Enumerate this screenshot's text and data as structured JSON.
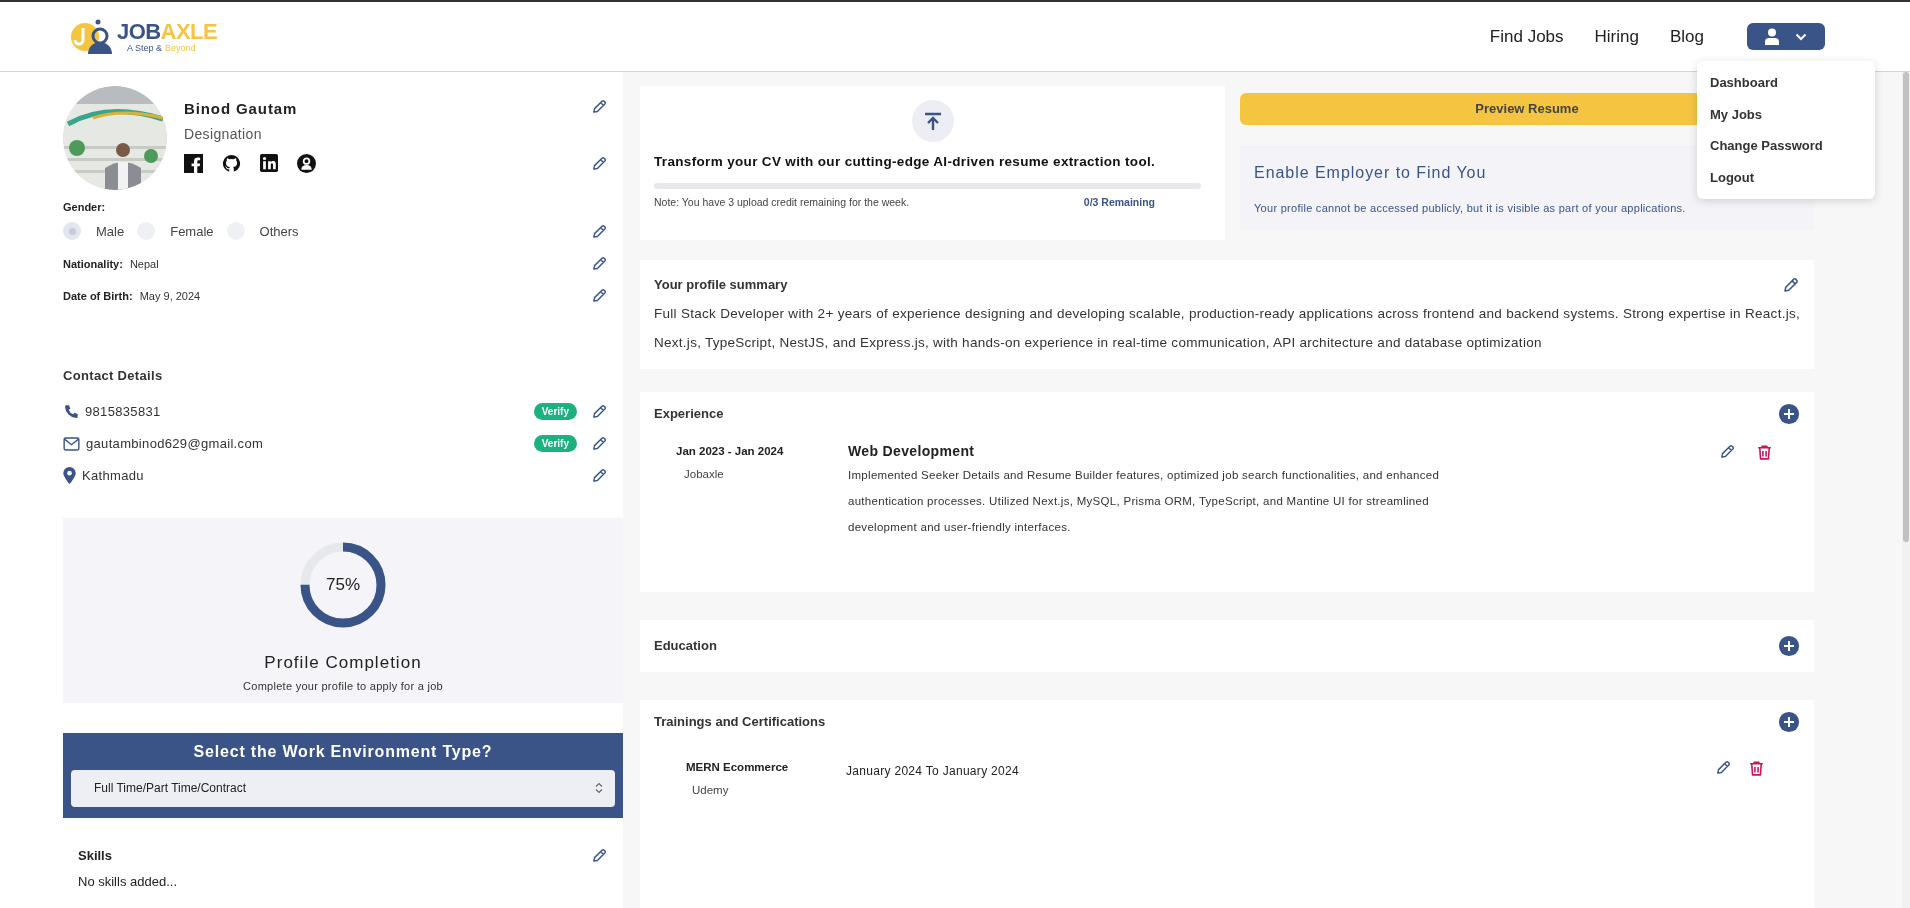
{
  "header": {
    "logo": {
      "name_part_1": "JOB",
      "name_part_2": "AXLE",
      "tagline_part_1": "A Step &",
      "tagline_part_2": "Beyond"
    },
    "nav": [
      {
        "label": "Find Jobs"
      },
      {
        "label": "Hiring"
      },
      {
        "label": "Blog"
      }
    ],
    "user_menu": {
      "expanded": true,
      "items": [
        {
          "label": "Dashboard"
        },
        {
          "label": "My Jobs"
        },
        {
          "label": "Change Password"
        },
        {
          "label": "Logout"
        }
      ]
    }
  },
  "profile": {
    "name": "Binod Gautam",
    "designation": "Designation",
    "gender": {
      "label": "Gender:",
      "options": [
        {
          "label": "Male",
          "selected": true
        },
        {
          "label": "Female",
          "selected": false
        },
        {
          "label": "Others",
          "selected": false
        }
      ]
    },
    "details": [
      {
        "label": "Nationality:",
        "value": "Nepal"
      },
      {
        "label": "Date of Birth:",
        "value": "May 9, 2024"
      }
    ]
  },
  "contact": {
    "title": "Contact Details",
    "items": [
      {
        "kind": "phone",
        "value": "9815835831",
        "badge": "Verify"
      },
      {
        "kind": "email",
        "value": "gautambinod629@gmail.com",
        "badge": "Verify"
      },
      {
        "kind": "location",
        "value": "Kathmadu"
      }
    ]
  },
  "completion": {
    "percent": "75%",
    "level": 0.75,
    "title": "Profile Completion",
    "subtitle": "Complete your profile to apply for a job"
  },
  "work_environment": {
    "title": "Select the Work Environment Type?",
    "value": "Full Time/Part Time/Contract"
  },
  "skills": {
    "title": "Skills",
    "empty_text": "No skills added..."
  },
  "upload": {
    "heading": "Transform your CV with our cutting-edge AI-driven resume extraction tool.",
    "level": 0,
    "note": "Note: You have 3 upload credit remaining for the week.",
    "remaining": "0/3 Remaining"
  },
  "preview_button": "Preview Resume",
  "employer": {
    "title": "Enable Employer to Find You",
    "text": "Your profile cannot be accessed publicly, but it is visible as part of your applications."
  },
  "summary": {
    "title": "Your profile summary",
    "text": "Full Stack Developer with 2+ years of experience designing and developing scalable, production-ready applications across frontend and backend systems. Strong expertise in React.js, Next.js, TypeScript, NestJS, and Express.js, with hands-on experience in real-time communication, API architecture and database optimization"
  },
  "experience": {
    "title": "Experience",
    "items": [
      {
        "dates": "Jan 2023 - Jan 2024",
        "company": "Jobaxle",
        "title": "Web Development",
        "description": "Implemented Seeker Details and Resume Builder features, optimized job search functionalities, and enhanced authentication processes. Utilized Next.js, MySQL, Prisma ORM, TypeScript, and Mantine UI for streamlined development and user-friendly interfaces."
      }
    ]
  },
  "education": {
    "title": "Education"
  },
  "trainings": {
    "title": "Trainings and Certifications",
    "items": [
      {
        "name": "MERN Ecommerce",
        "provider": "Udemy",
        "dates": "January 2024 To January 2024"
      }
    ]
  }
}
